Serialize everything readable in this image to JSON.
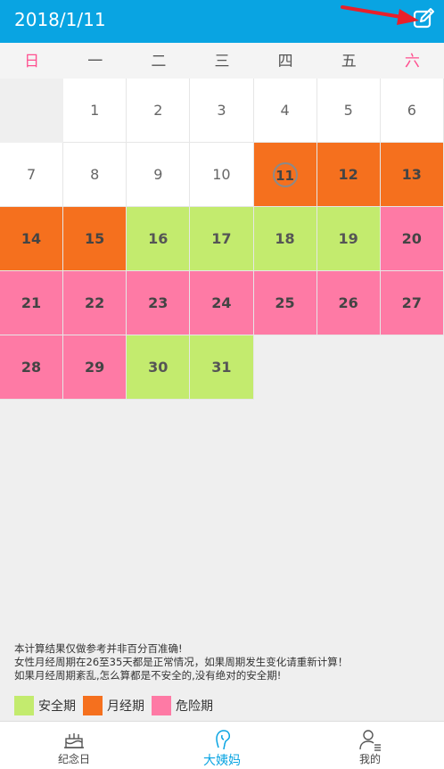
{
  "header": {
    "title": "2018/1/11"
  },
  "weekdays": [
    "日",
    "一",
    "二",
    "三",
    "四",
    "五",
    "六"
  ],
  "calendar": {
    "leading_empty": 1,
    "days": [
      {
        "d": "1",
        "t": "normal"
      },
      {
        "d": "2",
        "t": "normal"
      },
      {
        "d": "3",
        "t": "normal"
      },
      {
        "d": "4",
        "t": "normal"
      },
      {
        "d": "5",
        "t": "normal"
      },
      {
        "d": "6",
        "t": "normal"
      },
      {
        "d": "7",
        "t": "normal"
      },
      {
        "d": "8",
        "t": "normal"
      },
      {
        "d": "9",
        "t": "normal"
      },
      {
        "d": "10",
        "t": "normal"
      },
      {
        "d": "11",
        "t": "period",
        "today": true
      },
      {
        "d": "12",
        "t": "period"
      },
      {
        "d": "13",
        "t": "period"
      },
      {
        "d": "14",
        "t": "period"
      },
      {
        "d": "15",
        "t": "period"
      },
      {
        "d": "16",
        "t": "safe"
      },
      {
        "d": "17",
        "t": "safe"
      },
      {
        "d": "18",
        "t": "safe"
      },
      {
        "d": "19",
        "t": "safe"
      },
      {
        "d": "20",
        "t": "danger"
      },
      {
        "d": "21",
        "t": "danger"
      },
      {
        "d": "22",
        "t": "danger"
      },
      {
        "d": "23",
        "t": "danger"
      },
      {
        "d": "24",
        "t": "danger"
      },
      {
        "d": "25",
        "t": "danger"
      },
      {
        "d": "26",
        "t": "danger"
      },
      {
        "d": "27",
        "t": "danger"
      },
      {
        "d": "28",
        "t": "danger"
      },
      {
        "d": "29",
        "t": "danger"
      },
      {
        "d": "30",
        "t": "safe"
      },
      {
        "d": "31",
        "t": "safe"
      }
    ]
  },
  "notes": [
    "本计算结果仅做参考并非百分百准确!",
    "女性月经周期在26至35天都是正常情况，如果周期发生变化请重新计算！",
    "如果月经周期紊乱,怎么算都是不安全的,没有绝对的安全期!"
  ],
  "legend": [
    {
      "label": "安全期",
      "color": "#c3eb6e"
    },
    {
      "label": "月经期",
      "color": "#f5701e"
    },
    {
      "label": "危险期",
      "color": "#fe7aa5"
    }
  ],
  "tabs": [
    {
      "label": "纪念日",
      "icon": "cake-icon",
      "active": false
    },
    {
      "label": "大姨妈",
      "icon": "female-profile-icon",
      "active": true
    },
    {
      "label": "我的",
      "icon": "user-list-icon",
      "active": false
    }
  ],
  "colors": {
    "header": "#09a4e2",
    "accent_weekend": "#ff4f8f"
  }
}
